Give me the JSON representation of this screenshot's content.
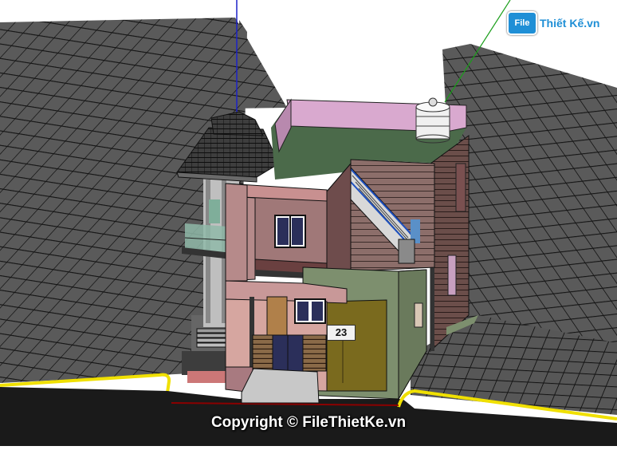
{
  "logo": {
    "badge_text": "File",
    "wordmark": "Thiết Kế.vn",
    "brand_color": "#1f8fd6"
  },
  "house": {
    "number": "23"
  },
  "watermark": {
    "copyright": "Copyright © FileThietKe.vn"
  },
  "colors": {
    "ground_tile": "#555555",
    "grid_line": "#111111",
    "curb_yellow": "#f0e000",
    "roof_pink": "#d9a9cf",
    "wall_green": "#7d8f6e",
    "garage_door": "#7a6a1e",
    "axis_blue": "#1d22c8",
    "axis_green": "#1a9e1a"
  }
}
